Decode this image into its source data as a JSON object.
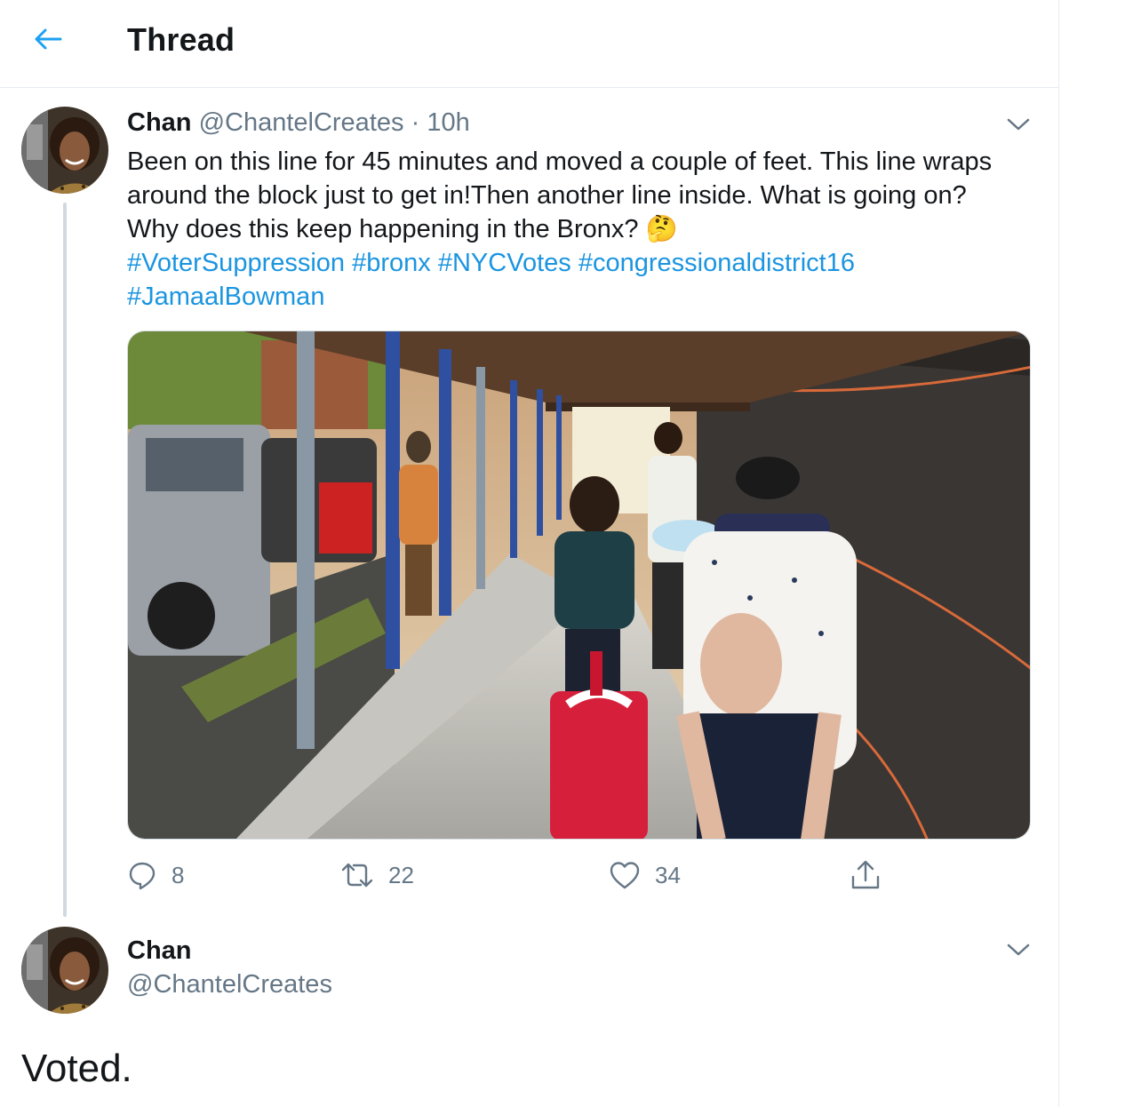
{
  "header": {
    "title": "Thread"
  },
  "tweet": {
    "name": "Chan",
    "handle": "@ChantelCreates",
    "separator": "·",
    "time": "10h",
    "text": "Been on this line for 45 minutes and moved a couple of feet. This line wraps around the block just to get in!Then another line inside. What is going on? Why does this keep happening in the Bronx?",
    "emoji": "🤔",
    "hashtags": [
      "#VoterSuppression",
      "#bronx",
      "#NYCVotes",
      "#congressionaldistrict16",
      "#JamaalBowman"
    ],
    "counts": {
      "replies": "8",
      "retweets": "22",
      "likes": "34"
    }
  },
  "reply": {
    "name": "Chan",
    "handle": "@ChantelCreates",
    "text": "Voted."
  },
  "colors": {
    "accent": "#1da1f2",
    "link": "#1b95e0",
    "muted": "#657786",
    "divider": "#e6ecf0"
  }
}
